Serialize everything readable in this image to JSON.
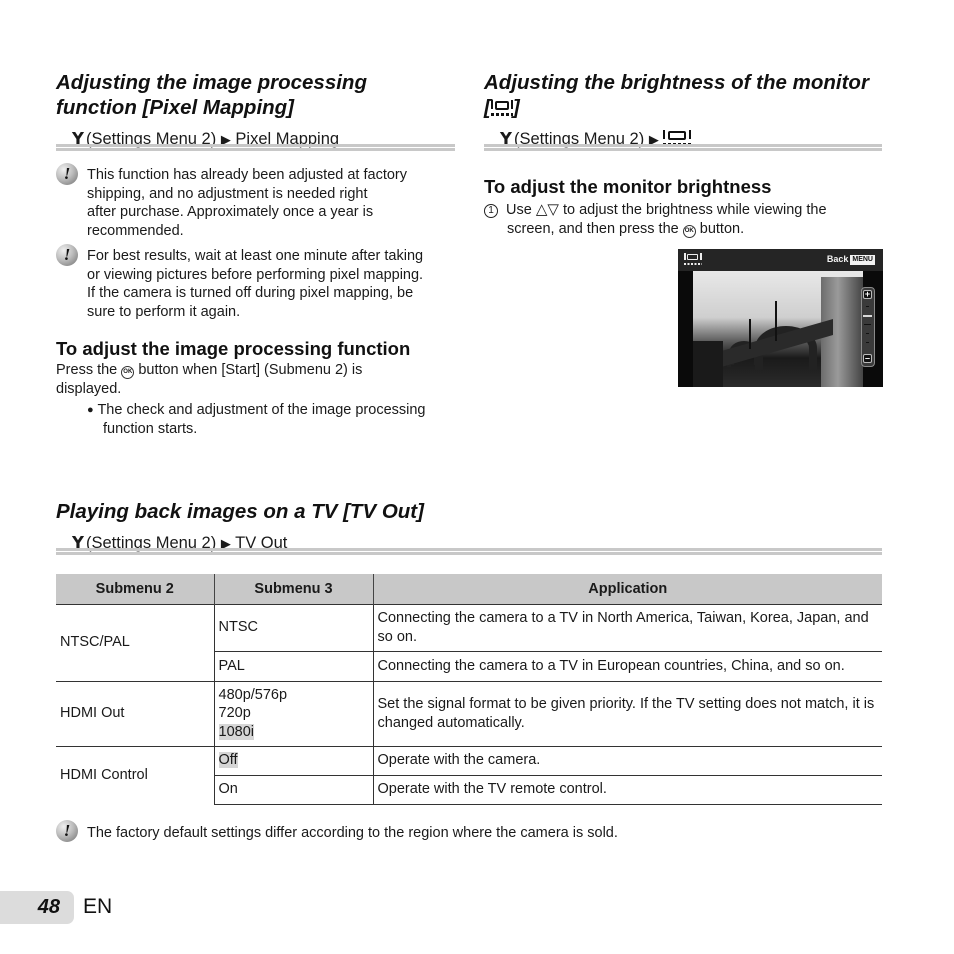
{
  "pixel_mapping": {
    "title_line1": "Adjusting the image processing",
    "title_line2": "function [Pixel Mapping]",
    "path_prefix": "(Settings Menu 2)",
    "path_arrow": "▶",
    "path_target": "Pixel Mapping",
    "notes": [
      {
        "lines": [
          "This function has already been adjusted at factory",
          "shipping, and no adjustment is needed right",
          "after purchase. Approximately once a year is",
          "recommended."
        ]
      },
      {
        "lines": [
          "For best results, wait at least one minute after taking",
          "or viewing pictures before performing pixel mapping.",
          "If the camera is turned off during pixel mapping, be",
          "sure to perform it again."
        ]
      }
    ],
    "subheading": "To adjust the image processing function",
    "press_before": "Press the",
    "ok_glyph": "OK",
    "press_after": "button when [Start] (Submenu 2) is",
    "press_line2": "displayed.",
    "bullet_glyph": "●",
    "bullet_line1": "The check and adjustment of the image processing",
    "bullet_line2": "function starts."
  },
  "monitor": {
    "title_line1": "Adjusting the brightness of the monitor",
    "title_bracket_open": "[",
    "title_bracket_close": "]",
    "path_prefix": "(Settings Menu 2)",
    "path_arrow": "▶",
    "subheading": "To adjust the monitor brightness",
    "step_number": "1",
    "step_use": "Use",
    "step_arrows": "△▽",
    "step_rest": "to adjust the brightness while viewing the",
    "step_line2_before": "screen, and then press the",
    "ok_glyph": "OK",
    "step_line2_after": "button.",
    "screen": {
      "back_label": "Back",
      "menu_label": "MENU",
      "plus": "+",
      "minus": "–"
    }
  },
  "tv_out": {
    "title": "Playing back images on a TV [TV Out]",
    "path_prefix": "(Settings Menu 2)",
    "path_arrow": "▶",
    "path_target": "TV Out",
    "table": {
      "headers": [
        "Submenu 2",
        "Submenu 3",
        "Application"
      ],
      "rows": [
        {
          "submenu2": "NTSC/PAL",
          "submenu3": "NTSC",
          "application": "Connecting the camera to a TV in North America, Taiwan, Korea, Japan, and so on."
        },
        {
          "submenu2": "",
          "submenu3": "PAL",
          "application": "Connecting the camera to a TV in European countries, China, and so on."
        },
        {
          "submenu2": "HDMI Out",
          "submenu3_options": [
            "480p/576p",
            "720p",
            "1080i"
          ],
          "default": "1080i",
          "application": "Set the signal format to be given priority. If the TV setting does not match, it is changed automatically."
        },
        {
          "submenu2": "HDMI Control",
          "submenu3": "Off",
          "default": "Off",
          "application": "Operate with the camera."
        },
        {
          "submenu2": "",
          "submenu3": "On",
          "application": "Operate with the TV remote control."
        }
      ]
    },
    "footnote": "The factory default settings differ according to the region where the camera is sold."
  },
  "footer": {
    "page_number": "48",
    "language": "EN"
  },
  "icons": {
    "wrench": "ı",
    "note": "!"
  },
  "colors": {
    "header_fill": "#c8c8c8",
    "highlight": "#d6d6d6",
    "page_tab": "#dcdcdc"
  }
}
